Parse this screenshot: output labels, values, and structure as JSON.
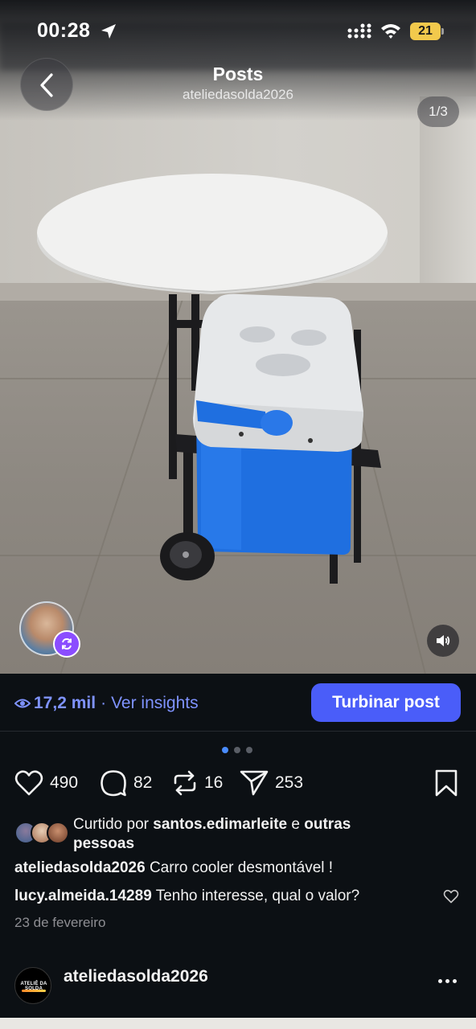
{
  "status_bar": {
    "time": "00:28",
    "battery_level": "21",
    "icons": [
      "location-arrow-icon",
      "cellular-signal-icon",
      "wifi-icon",
      "battery-icon"
    ]
  },
  "header": {
    "title": "Posts",
    "username": "ateliedasolda2026",
    "image_counter": "1/3"
  },
  "insights": {
    "views": "17,2 mil",
    "separator": "·",
    "link": "Ver insights",
    "boost_button": "Turbinar post"
  },
  "carousel": {
    "total": 3,
    "active": 1
  },
  "actions": {
    "likes": "490",
    "comments": "82",
    "reposts": "16",
    "shares": "253"
  },
  "liked_by": {
    "prefix": "Curtido por",
    "user": "santos.edimarleite",
    "connector": "e",
    "suffix": "outras pessoas"
  },
  "caption": {
    "username": "ateliedasolda2026",
    "text": "Carro cooler  desmontável !"
  },
  "comment": {
    "username": "lucy.almeida.14289",
    "text": "Tenho interesse,  qual o valor?"
  },
  "date": "23 de fevereiro",
  "next_post": {
    "avatar_text": "ATELIÊ DA SOLDA",
    "username": "ateliedasolda2026"
  },
  "colors": {
    "accent": "#4a5df9",
    "link": "#7f93ff",
    "background": "#0c1014",
    "battery": "#f2c94c",
    "remix_badge": "#8b4dff",
    "cooler_blue": "#1f6fe0"
  }
}
